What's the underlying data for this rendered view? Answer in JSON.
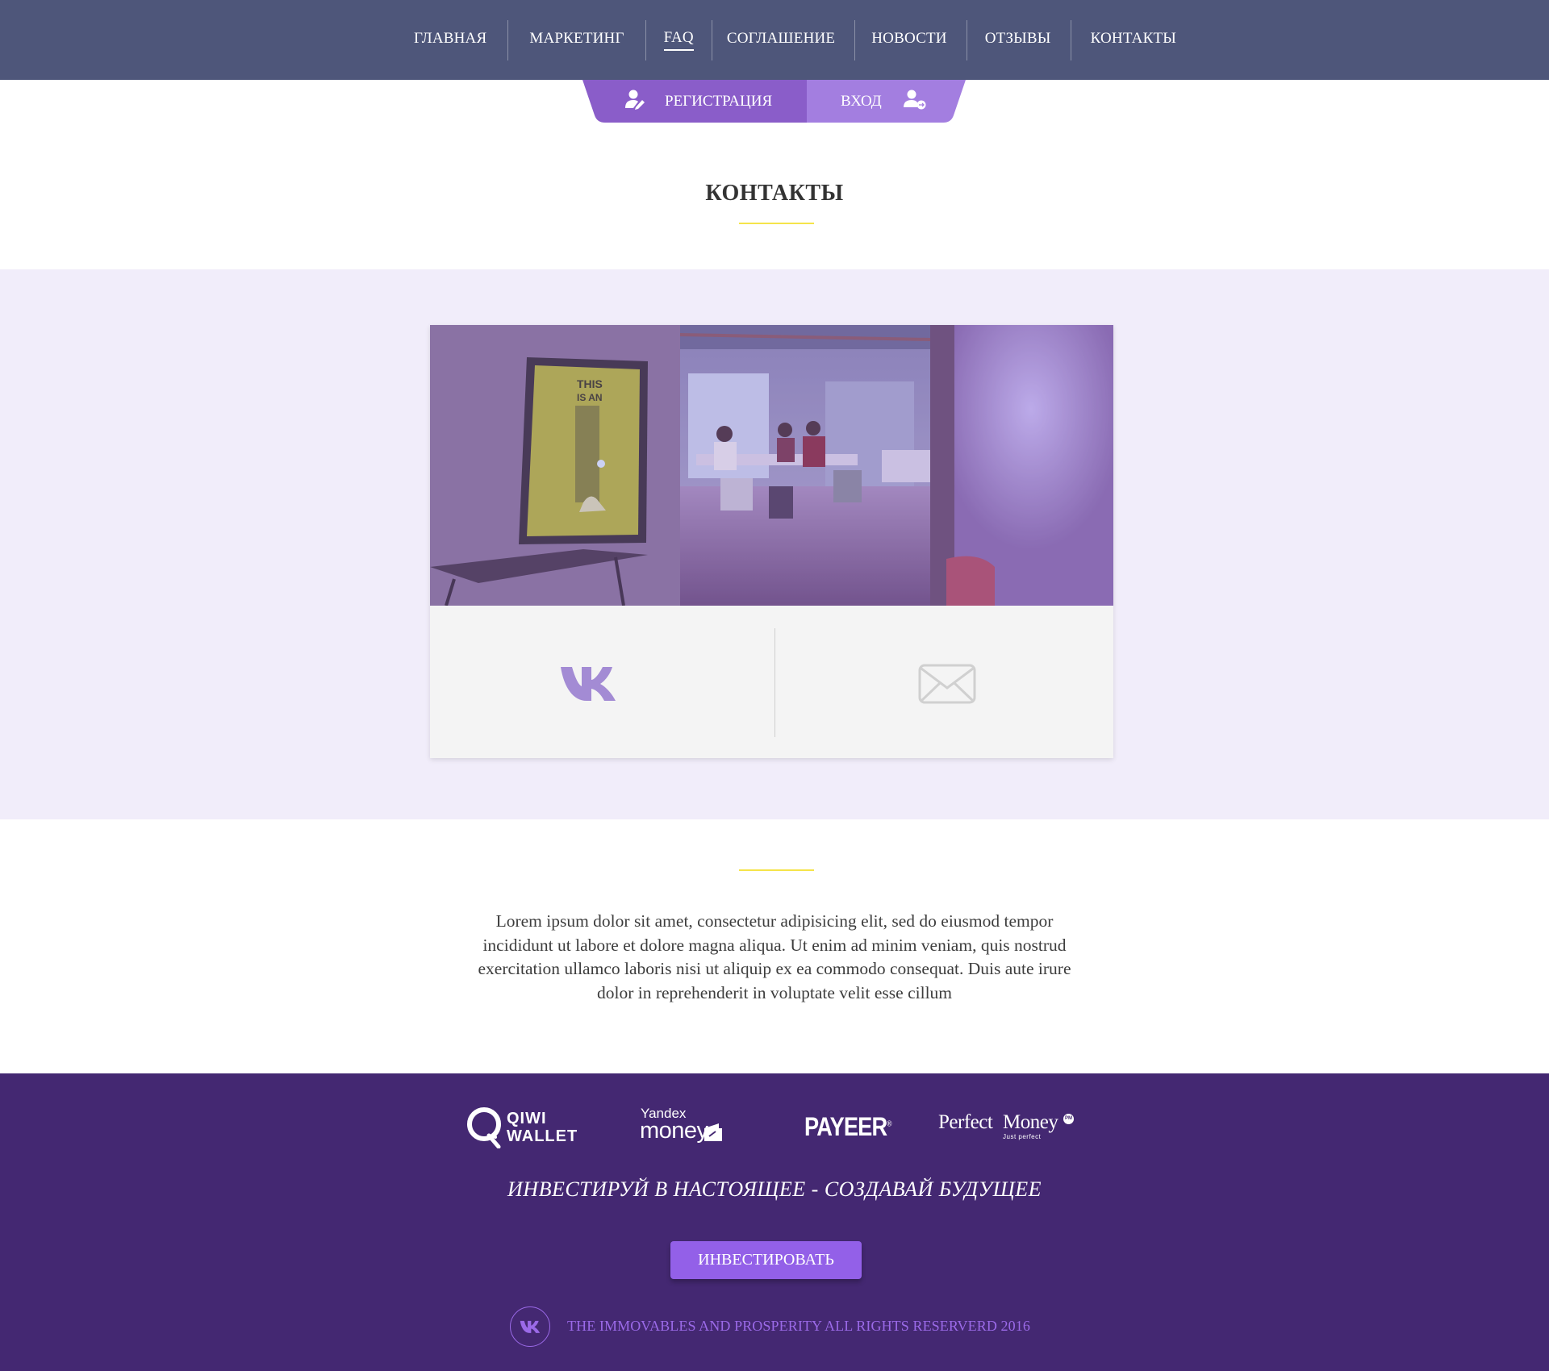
{
  "nav": {
    "items": [
      {
        "label": "ГЛАВНАЯ"
      },
      {
        "label": "МАРКЕТИНГ"
      },
      {
        "label": "FAQ"
      },
      {
        "label": "СОГЛАШЕНИЕ"
      },
      {
        "label": "НОВОСТИ"
      },
      {
        "label": "ОТЗЫВЫ"
      },
      {
        "label": "КОНТАКТЫ"
      }
    ],
    "active_label": "FAQ"
  },
  "auth": {
    "register_label": "РЕГИСТРАЦИЯ",
    "login_label": "ВХОД"
  },
  "page": {
    "title": "КОНТАКТЫ"
  },
  "contacts": {
    "vk_icon": "vk-icon",
    "mail_icon": "mail-icon"
  },
  "about": {
    "text": "Lorem ipsum dolor sit amet, consectetur adipisicing elit, sed do eiusmod tempor incididunt ut labore et dolore magna aliqua. Ut enim ad minim veniam, quis nostrud exercitation ullamco laboris nisi ut aliquip ex ea commodo consequat. Duis aute irure dolor in reprehenderit in voluptate velit esse cillum"
  },
  "footer": {
    "payments": {
      "qiwi_line1": "QIWI",
      "qiwi_line2": "WALLET",
      "yandex_line1": "Yandex",
      "yandex_line2": "money",
      "payeer": "PAYEER",
      "pm_word1": "Perfect",
      "pm_word2": "Money",
      "pm_tagline": "Just perfect"
    },
    "slogan": "ИНВЕСТИРУЙ В НАСТОЯЩЕЕ - СОЗДАВАЙ БУДУЩЕЕ",
    "invest_button": "ИНВЕСТИРОВАТЬ",
    "copyright": "THE IMMOVABLES AND PROSPERITY ALL RIGHTS RESERVERD 2016"
  },
  "colors": {
    "nav_bg": "#4e567a",
    "accent_purple": "#9360e8",
    "auth_reg_bg": "#8a5dc9",
    "auth_login_bg": "#a37ee0",
    "title_underline": "#f5e44a",
    "contact_band_bg": "#f1edfa",
    "footer_bg": "#442872",
    "vk_icon": "#a38bd4",
    "copyright_text": "#9b6ae8"
  }
}
